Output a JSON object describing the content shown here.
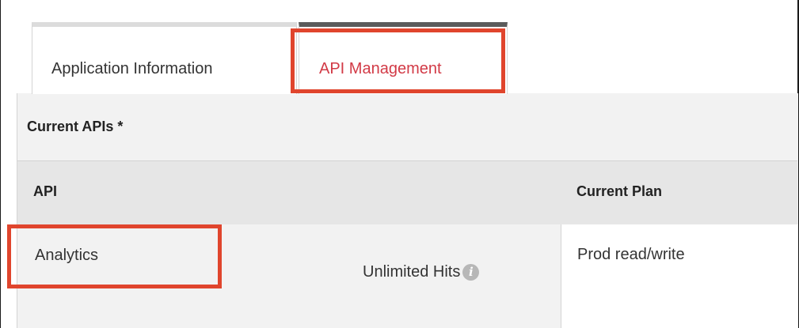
{
  "tabs": [
    {
      "label": "Application Information",
      "active": false
    },
    {
      "label": "API Management",
      "active": true
    }
  ],
  "section": {
    "title": "Current APIs *"
  },
  "table": {
    "columns": [
      "API",
      "Current Plan"
    ],
    "rows": [
      {
        "api": "Analytics",
        "hits": "Unlimited Hits",
        "plan": "Prod read/write"
      }
    ]
  },
  "icons": {
    "info": "info-icon"
  },
  "colors": {
    "active_tab_text": "#d23a46",
    "highlight": "#e0452d",
    "header_bg": "#e6e6e6",
    "panel_bg": "#f2f2f2"
  }
}
